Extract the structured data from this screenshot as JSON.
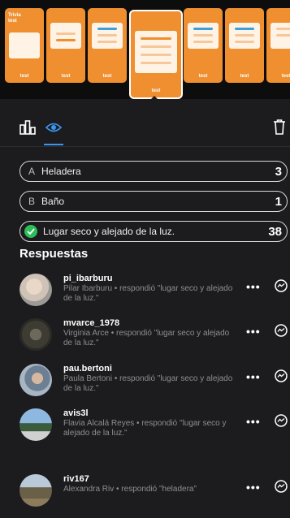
{
  "strip": {
    "thumbs": [
      {
        "title": "Trivia\ntest",
        "tag": "test"
      },
      {
        "tag": "test"
      },
      {
        "tag": "test"
      },
      {
        "tag": "test"
      },
      {
        "tag": "test"
      },
      {
        "tag": "test"
      },
      {
        "tag": "test"
      }
    ]
  },
  "toolbar": {
    "icons": [
      "bar-chart-icon",
      "eye-icon",
      "trash-icon"
    ],
    "accent": "#3897f0"
  },
  "options": [
    {
      "letter": "A",
      "text": "Heladera",
      "count": "3",
      "correct": false
    },
    {
      "letter": "B",
      "text": "Baño",
      "count": "1",
      "correct": false
    },
    {
      "letter": "",
      "text": "Lugar seco y alejado de la luz.",
      "count": "38",
      "correct": true
    }
  ],
  "responses": {
    "title": "Respuestas",
    "items": [
      {
        "username": "pi_ibarburu",
        "text": "Pilar Ibarburu • respondió \"lugar seco y alejado de la luz.\""
      },
      {
        "username": "mvarce_1978",
        "text": "Virginia Arce • respondió \"lugar seco y alejado de la luz.\""
      },
      {
        "username": "pau.bertoni",
        "text": "Paula Bertoni • respondió \"lugar seco y alejado de la luz.\""
      },
      {
        "username": "avis3l",
        "text": "Flavia Alcalá Reyes • respondió \"lugar seco y alejado de la luz.\""
      },
      {
        "username": "riv167",
        "text": "Alexandra Riv • respondió \"heladera\""
      }
    ]
  },
  "colors": {
    "correct": "#2bbf5a",
    "card": "#ef8f2f"
  }
}
